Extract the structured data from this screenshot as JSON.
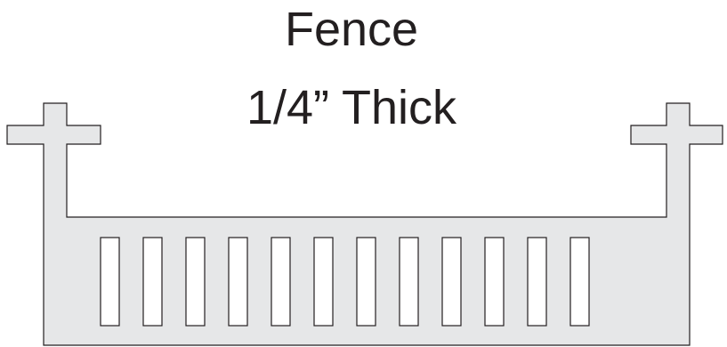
{
  "diagram": {
    "title_line_1": "Fence",
    "title_line_2": "1/4” Thick",
    "colors": {
      "fill": "#e6e7e8",
      "stroke": "#231f20",
      "text": "#231f20",
      "slot": "#ffffff"
    },
    "slot_count": 12
  }
}
